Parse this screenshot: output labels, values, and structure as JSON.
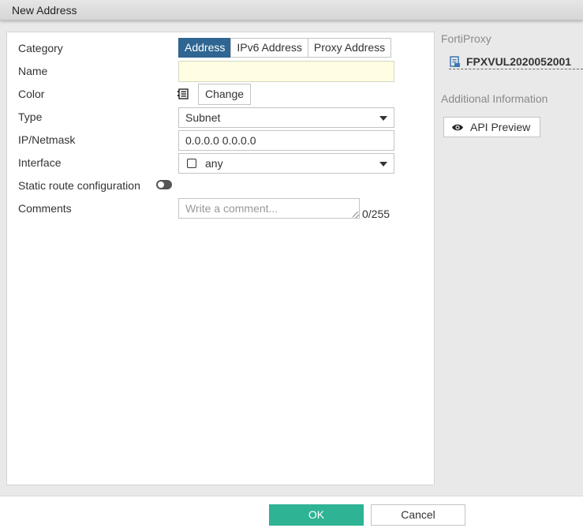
{
  "window": {
    "title": "New Address"
  },
  "form": {
    "labels": {
      "category": "Category",
      "name": "Name",
      "color": "Color",
      "type": "Type",
      "ip_netmask": "IP/Netmask",
      "interface": "Interface",
      "static_route": "Static route configuration",
      "comments": "Comments"
    },
    "category_options": [
      "Address",
      "IPv6 Address",
      "Proxy Address"
    ],
    "category_selected": "Address",
    "name_value": "",
    "color": {
      "change_label": "Change",
      "icon": "color-swatch-icon"
    },
    "type_value": "Subnet",
    "ip_netmask_value": "0.0.0.0 0.0.0.0",
    "interface_value": "any",
    "static_route_enabled": false,
    "comments": {
      "placeholder": "Write a comment...",
      "value": "",
      "count": "0/255"
    }
  },
  "side": {
    "product_label": "FortiProxy",
    "device_name": "FPXVUL2020052001",
    "additional_info_label": "Additional Information",
    "api_preview_label": "API Preview"
  },
  "footer": {
    "ok_label": "OK",
    "cancel_label": "Cancel"
  },
  "colors": {
    "accent": "#2f6592",
    "ok": "#2eb394",
    "name_bg": "#fffde2"
  }
}
